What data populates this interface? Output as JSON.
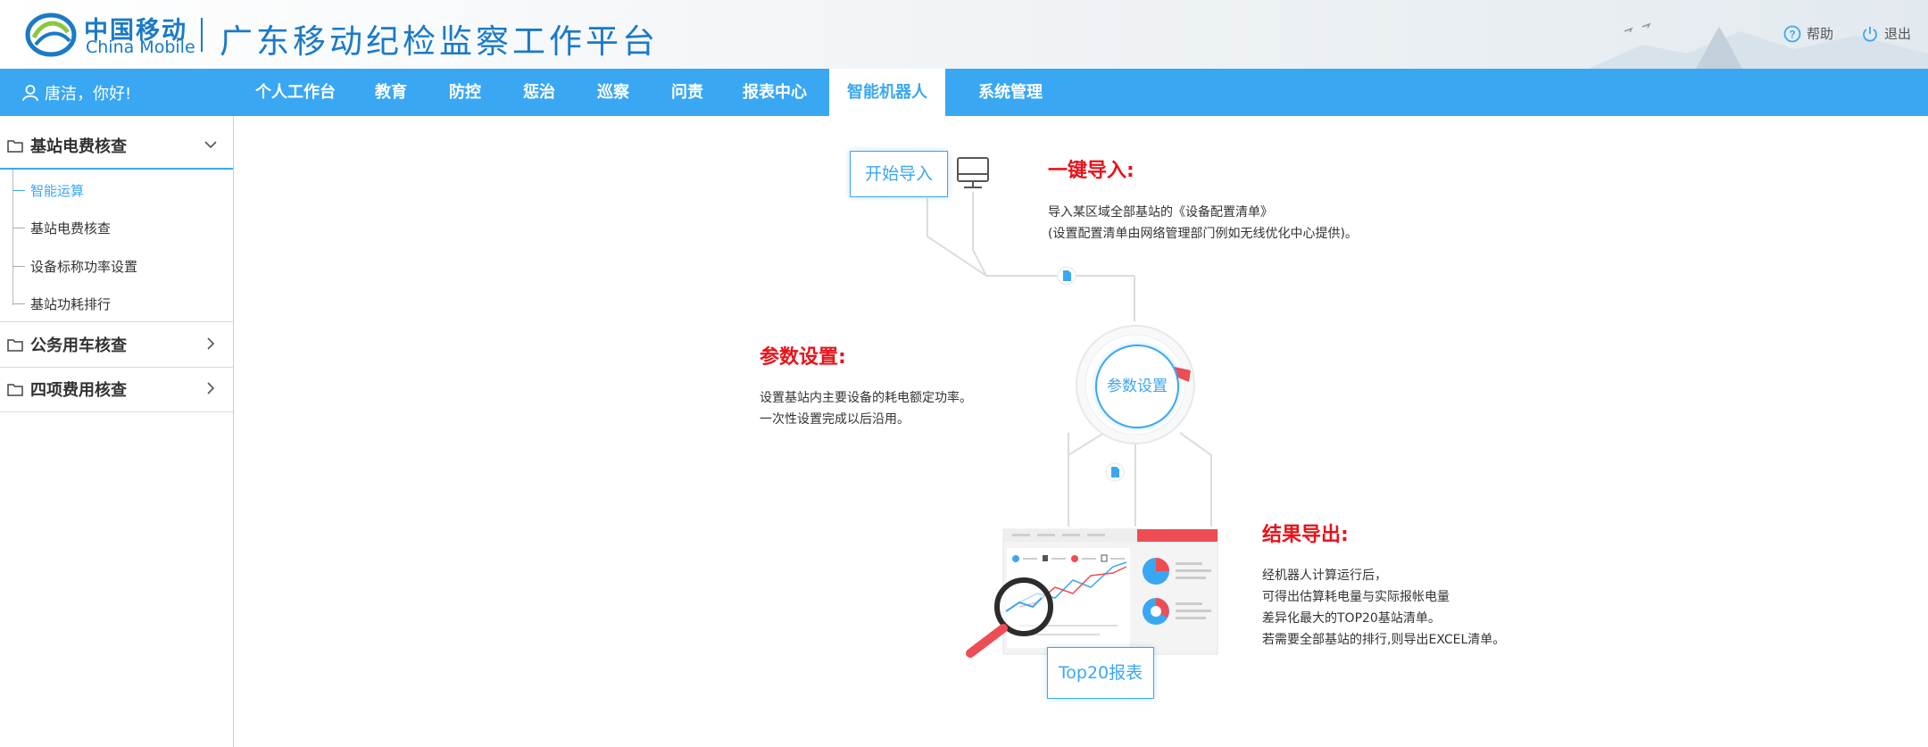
{
  "header": {
    "brand_cn": "中国移动",
    "brand_en": "China Mobile",
    "platform_title": "广东移动纪检监察工作平台",
    "help_label": "帮助",
    "logout_label": "退出"
  },
  "nav": {
    "greeting": "唐洁，你好!",
    "items": [
      {
        "label": "个人工作台"
      },
      {
        "label": "教育"
      },
      {
        "label": "防控"
      },
      {
        "label": "惩治"
      },
      {
        "label": "巡察"
      },
      {
        "label": "问责"
      },
      {
        "label": "报表中心"
      },
      {
        "label": "智能机器人"
      },
      {
        "label": "系统管理"
      }
    ],
    "active_item": "智能机器人"
  },
  "sidebar": {
    "groups": [
      {
        "label": "基站电费核查",
        "expanded": true,
        "items": [
          {
            "label": "智能运算",
            "active": true
          },
          {
            "label": "基站电费核查"
          },
          {
            "label": "设备标称功率设置"
          },
          {
            "label": "基站功耗排行"
          }
        ]
      },
      {
        "label": "公务用车核查",
        "expanded": false
      },
      {
        "label": "四项费用核查",
        "expanded": false
      }
    ]
  },
  "main": {
    "start_import_button": "开始导入",
    "param_button": "参数设置",
    "report_button": "Top20报表",
    "import_section": {
      "title": "一键导入:",
      "lines": [
        "导入某区域全部基站的《设备配置清单》",
        "(设置配置清单由网络管理部门例如无线优化中心提供)。"
      ]
    },
    "param_section": {
      "title": "参数设置:",
      "lines": [
        "设置基站内主要设备的耗电额定功率。",
        "一次性设置完成以后沿用。"
      ]
    },
    "result_section": {
      "title": "结果导出:",
      "lines": [
        "经机器人计算运行后，",
        "可得出估算耗电量与实际报帐电量",
        "差异化最大的TOP20基站清单。",
        "若需要全部基站的排行,则导出EXCEL清单。"
      ]
    }
  },
  "colors": {
    "accent": "#3aa7f3",
    "brand": "#1a7ac7",
    "highlight_red": "#e8121a"
  }
}
